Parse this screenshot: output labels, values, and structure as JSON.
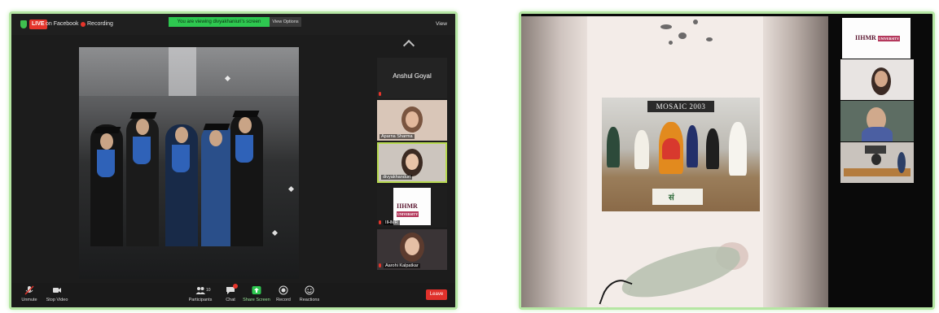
{
  "left_window": {
    "topbar": {
      "live_label": "LIVE",
      "facebook_label": "on Facebook",
      "recording_label": "Recording",
      "share_banner": "You are viewing divyakhaniuri's screen",
      "view_options": "View Options",
      "view_button": "View"
    },
    "participants": [
      {
        "name": "Anshul Goyal",
        "tile": "name-only"
      },
      {
        "name": "Aparna Sharma",
        "tile": "video"
      },
      {
        "name": "divyakhanduri",
        "tile": "video",
        "active": true
      },
      {
        "name": "IIHMR",
        "tile": "logo",
        "muted": true
      },
      {
        "name": "Aarohi Kalpatkar",
        "tile": "video",
        "muted": true
      }
    ],
    "logo_text": "IIHMR",
    "logo_tag": "UNIVERSITY",
    "toolbar": {
      "unmute": "Unmute",
      "stop_video": "Stop Video",
      "participants": "Participants",
      "participants_count": "10",
      "chat": "Chat",
      "share_screen": "Share Screen",
      "record": "Record",
      "reactions": "Reactions",
      "leave": "Leave"
    }
  },
  "right_window": {
    "stage_banner": "MOSAIC 2003",
    "mat_text": "सं",
    "logo_text": "IIHMR",
    "logo_tag": "UNIVERSITY"
  },
  "colors": {
    "frame_border": "#b5e6a3",
    "zoom_green": "#2ec850",
    "live_red": "#e5352b",
    "leave_red": "#e0312b",
    "active_speaker": "#b6d94f"
  }
}
